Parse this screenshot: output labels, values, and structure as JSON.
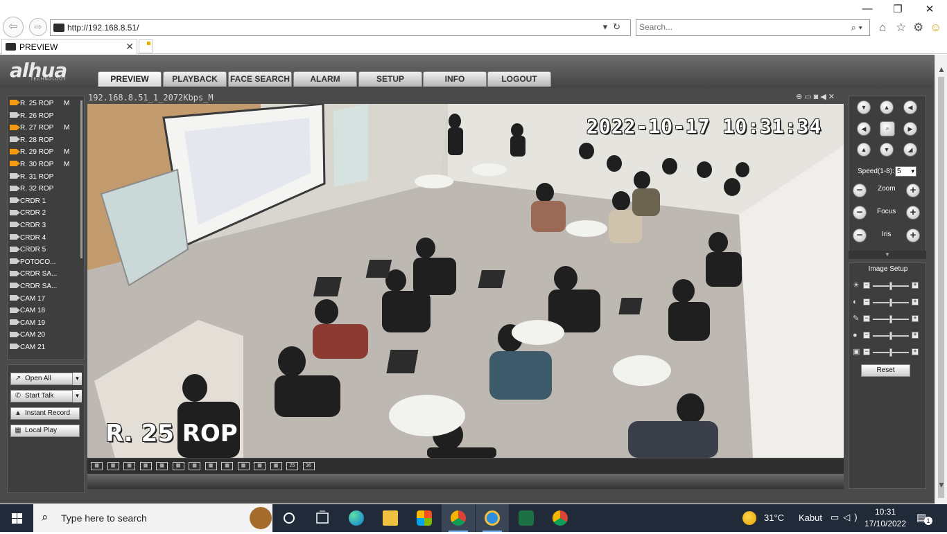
{
  "browser": {
    "url": "http://192.168.8.51/",
    "search_placeholder": "Search...",
    "tab_title": "PREVIEW"
  },
  "app": {
    "logo": "alhua",
    "logo_sub": "TECHNOLOGY",
    "nav": [
      "PREVIEW",
      "PLAYBACK",
      "FACE SEARCH",
      "ALARM",
      "SETUP",
      "INFO",
      "LOGOUT"
    ],
    "active_tab": "PREVIEW"
  },
  "cameras": [
    {
      "name": "R. 25 ROP",
      "flag": "M",
      "active": true
    },
    {
      "name": "R. 26 ROP",
      "flag": "",
      "active": false
    },
    {
      "name": "R. 27 ROP",
      "flag": "M",
      "active": true
    },
    {
      "name": "R. 28 ROP",
      "flag": "",
      "active": false
    },
    {
      "name": "R. 29 ROP",
      "flag": "M",
      "active": true
    },
    {
      "name": "R. 30 ROP",
      "flag": "M",
      "active": true
    },
    {
      "name": "R. 31 ROP",
      "flag": "",
      "active": false
    },
    {
      "name": "R. 32 ROP",
      "flag": "",
      "active": false
    },
    {
      "name": "CRDR 1",
      "flag": "",
      "active": false
    },
    {
      "name": "CRDR 2",
      "flag": "",
      "active": false
    },
    {
      "name": "CRDR 3",
      "flag": "",
      "active": false
    },
    {
      "name": "CRDR 4",
      "flag": "",
      "active": false
    },
    {
      "name": "CRDR 5",
      "flag": "",
      "active": false
    },
    {
      "name": "POTOCO...",
      "flag": "",
      "active": false
    },
    {
      "name": "CRDR SA...",
      "flag": "",
      "active": false
    },
    {
      "name": "CRDR SA...",
      "flag": "",
      "active": false
    },
    {
      "name": "CAM 17",
      "flag": "",
      "active": false
    },
    {
      "name": "CAM 18",
      "flag": "",
      "active": false
    },
    {
      "name": "CAM 19",
      "flag": "",
      "active": false
    },
    {
      "name": "CAM 20",
      "flag": "",
      "active": false
    },
    {
      "name": "CAM 21",
      "flag": "",
      "active": false
    }
  ],
  "controls": {
    "open_all": "Open All",
    "start_talk": "Start Talk",
    "instant_record": "Instant Record",
    "local_play": "Local Play"
  },
  "video": {
    "stream_title": "192.168.8.51_1_2072Kbps_M",
    "osd_time": "2022-10-17 10:31:34",
    "osd_name": "R. 25 ROP"
  },
  "layout_buttons": [
    "",
    "",
    "",
    "",
    "",
    "",
    "",
    "",
    "",
    "",
    "",
    "",
    "25",
    "36"
  ],
  "ptz": {
    "speed_label": "Speed(1-8):",
    "speed_value": "5",
    "zoom_label": "Zoom",
    "focus_label": "Focus",
    "iris_label": "Iris"
  },
  "image_setup": {
    "title": "Image Setup",
    "reset_label": "Reset",
    "sliders": [
      {
        "icon": "brightness-icon",
        "value": 0.5
      },
      {
        "icon": "contrast-icon",
        "value": 0.5
      },
      {
        "icon": "saturation-icon",
        "value": 0.5
      },
      {
        "icon": "hue-icon",
        "value": 0.5
      },
      {
        "icon": "gain-icon",
        "value": 0.5
      }
    ]
  },
  "taskbar": {
    "search_text": "Type here to search",
    "temperature": "31°C",
    "weather": "Kabut",
    "time": "10:31",
    "date": "17/10/2022",
    "notification_count": "1"
  },
  "colors": {
    "app_bg": "#4a4a4a",
    "panel_bg": "#3e3e3e",
    "active_camera": "#f39a12",
    "taskbar_bg": "#202a38"
  }
}
